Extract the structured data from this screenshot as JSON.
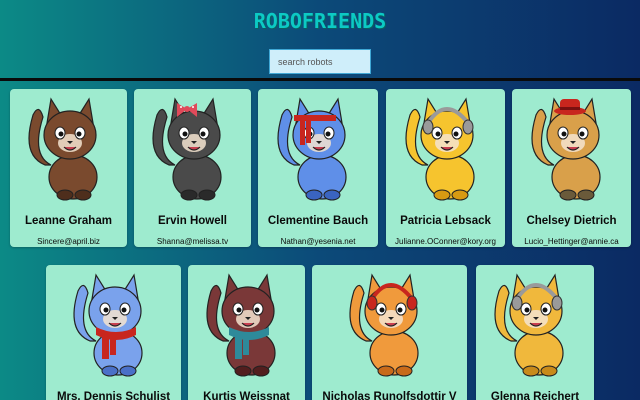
{
  "app": {
    "title": "ROBOFRIENDS"
  },
  "search": {
    "placeholder": "search robots",
    "value": ""
  },
  "theme": {
    "card_bg": "#9eebcf",
    "title_color": "#0ccac4"
  },
  "robots": [
    {
      "name": "Leanne Graham",
      "email": "Sincere@april.biz",
      "cat_color": "#7a4a2e",
      "cat_dark": "#4e2e1c",
      "accessory": "none",
      "accessory_color": ""
    },
    {
      "name": "Ervin Howell",
      "email": "Shanna@melissa.tv",
      "cat_color": "#4a4a4a",
      "cat_dark": "#2a2a2a",
      "accessory": "bow",
      "accessory_color": "#e04a5a"
    },
    {
      "name": "Clementine Bauch",
      "email": "Nathan@yesenia.net",
      "cat_color": "#5f8fe8",
      "cat_dark": "#3a64c0",
      "accessory": "headband",
      "accessory_color": "#c8261e"
    },
    {
      "name": "Patricia Lebsack",
      "email": "Julianne.OConner@kory.org",
      "cat_color": "#f6c42e",
      "cat_dark": "#d89a12",
      "accessory": "headphones",
      "accessory_color": "#9a9a9a"
    },
    {
      "name": "Chelsey Dietrich",
      "email": "Lucio_Hettinger@annie.ca",
      "cat_color": "#d9a04a",
      "cat_dark": "#6a5a3a",
      "accessory": "hat",
      "accessory_color": "#c8261e"
    },
    {
      "name": "Mrs. Dennis Schulist",
      "email": "",
      "cat_color": "#7aa2ec",
      "cat_dark": "#4a70c8",
      "accessory": "scarf",
      "accessory_color": "#c8261e"
    },
    {
      "name": "Kurtis Weissnat",
      "email": "",
      "cat_color": "#7a3838",
      "cat_dark": "#521e1e",
      "accessory": "scarf",
      "accessory_color": "#2e8a9a"
    },
    {
      "name": "Nicholas Runolfsdottir V",
      "email": "",
      "cat_color": "#f09a3c",
      "cat_dark": "#c86a1a",
      "accessory": "headphones",
      "accessory_color": "#c8261e"
    },
    {
      "name": "Glenna Reichert",
      "email": "",
      "cat_color": "#f0b83c",
      "cat_dark": "#c88a1a",
      "accessory": "headphones",
      "accessory_color": "#9a9a9a"
    }
  ]
}
